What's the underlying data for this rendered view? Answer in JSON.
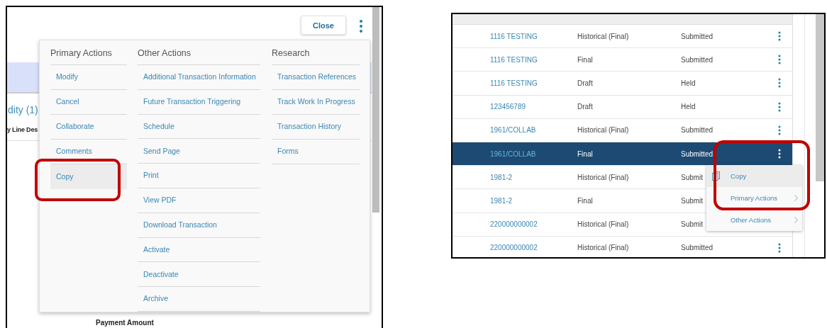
{
  "detail_view": {
    "close_button": "Close",
    "background": {
      "tab_label": "dity (1)",
      "column_header": "y Line Des",
      "field_label": "Payment Amount"
    },
    "actions_menu": {
      "columns": [
        {
          "heading": "Primary Actions",
          "items": [
            {
              "label": "Modify",
              "selected": false
            },
            {
              "label": "Cancel",
              "selected": false
            },
            {
              "label": "Collaborate",
              "selected": false
            },
            {
              "label": "Comments",
              "selected": false
            },
            {
              "label": "Copy",
              "selected": true
            }
          ]
        },
        {
          "heading": "Other Actions",
          "items": [
            {
              "label": "Additional Transaction Information",
              "selected": false
            },
            {
              "label": "Future Transaction Triggering",
              "selected": false
            },
            {
              "label": "Schedule",
              "selected": false
            },
            {
              "label": "Send Page",
              "selected": false
            },
            {
              "label": "Print",
              "selected": false
            },
            {
              "label": "View PDF",
              "selected": false
            },
            {
              "label": "Download Transaction",
              "selected": false
            },
            {
              "label": "Activate",
              "selected": false
            },
            {
              "label": "Deactivate",
              "selected": false
            },
            {
              "label": "Archive",
              "selected": false
            }
          ]
        },
        {
          "heading": "Research",
          "items": [
            {
              "label": "Transaction References",
              "selected": false
            },
            {
              "label": "Track Work In Progress",
              "selected": false
            },
            {
              "label": "Transaction History",
              "selected": false
            },
            {
              "label": "Forms",
              "selected": false
            }
          ]
        }
      ]
    }
  },
  "list_view": {
    "rows": [
      {
        "reference": "1116 TESTING",
        "type": "Historical (Final)",
        "status": "Submitted",
        "selected": false
      },
      {
        "reference": "1116 TESTING",
        "type": "Final",
        "status": "Submitted",
        "selected": false
      },
      {
        "reference": "1116 TESTING",
        "type": "Draft",
        "status": "Held",
        "selected": false
      },
      {
        "reference": "123456789",
        "type": "Draft",
        "status": "Held",
        "selected": false
      },
      {
        "reference": "1961/COLLAB",
        "type": "Historical (Final)",
        "status": "Submitted",
        "selected": false
      },
      {
        "reference": "1961/COLLAB",
        "type": "Final",
        "status": "Submitted",
        "selected": true
      },
      {
        "reference": "1981-2",
        "type": "Historical (Final)",
        "status": "Submit",
        "selected": false
      },
      {
        "reference": "1981-2",
        "type": "Final",
        "status": "Submit",
        "selected": false
      },
      {
        "reference": "220000000002",
        "type": "Historical (Final)",
        "status": "Submit",
        "selected": false
      },
      {
        "reference": "220000000002",
        "type": "Historical (Final)",
        "status": "Submitted",
        "selected": false
      }
    ],
    "row_menu": {
      "items": [
        {
          "label": "Copy",
          "kind": "action",
          "selected": true
        },
        {
          "label": "Primary Actions",
          "kind": "submenu",
          "selected": false
        },
        {
          "label": "Other Actions",
          "kind": "submenu",
          "selected": false
        }
      ]
    }
  }
}
